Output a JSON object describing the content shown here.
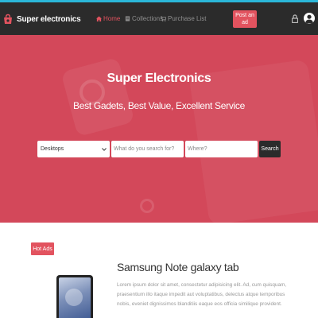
{
  "colors": {
    "accent": "#e2535f",
    "navbar": "#2b2b2b",
    "hero": "#d3485a",
    "topline": "#2bb7d9"
  },
  "navbar": {
    "brand": "Super electronics",
    "logo_icon": "shopping-bag-logo-icon",
    "links": [
      {
        "label": "Home",
        "icon": "home-icon",
        "active": true
      },
      {
        "label": "Collections",
        "icon": "collection-icon",
        "active": false
      },
      {
        "label": "Purchase List",
        "icon": "cart-icon",
        "active": false
      }
    ],
    "post_button": "Post an ad",
    "lock_icon": "lock-icon",
    "avatar_icon": "user-avatar-icon"
  },
  "hero": {
    "title": "Super Electronics",
    "subtitle": "Best Gadets, Best Value, Excellent Service",
    "search": {
      "category_selected": "Desktops",
      "what_placeholder": "What do you search for?",
      "where_placeholder": "Where?",
      "button": "Search"
    }
  },
  "hot_ads": {
    "badge": "Hot Ads",
    "item": {
      "title": "Samsung Note galaxy tab",
      "description": "Lorem ipsum dolor sit amet, consectetur adipisicing elit. Ad, cum quisquam, praesentium illo itaque impedit aut voluptatibus, delectus atque temporibus nobis, eveniet dignissimos blanditiis eaque eos officia similique provident."
    }
  }
}
